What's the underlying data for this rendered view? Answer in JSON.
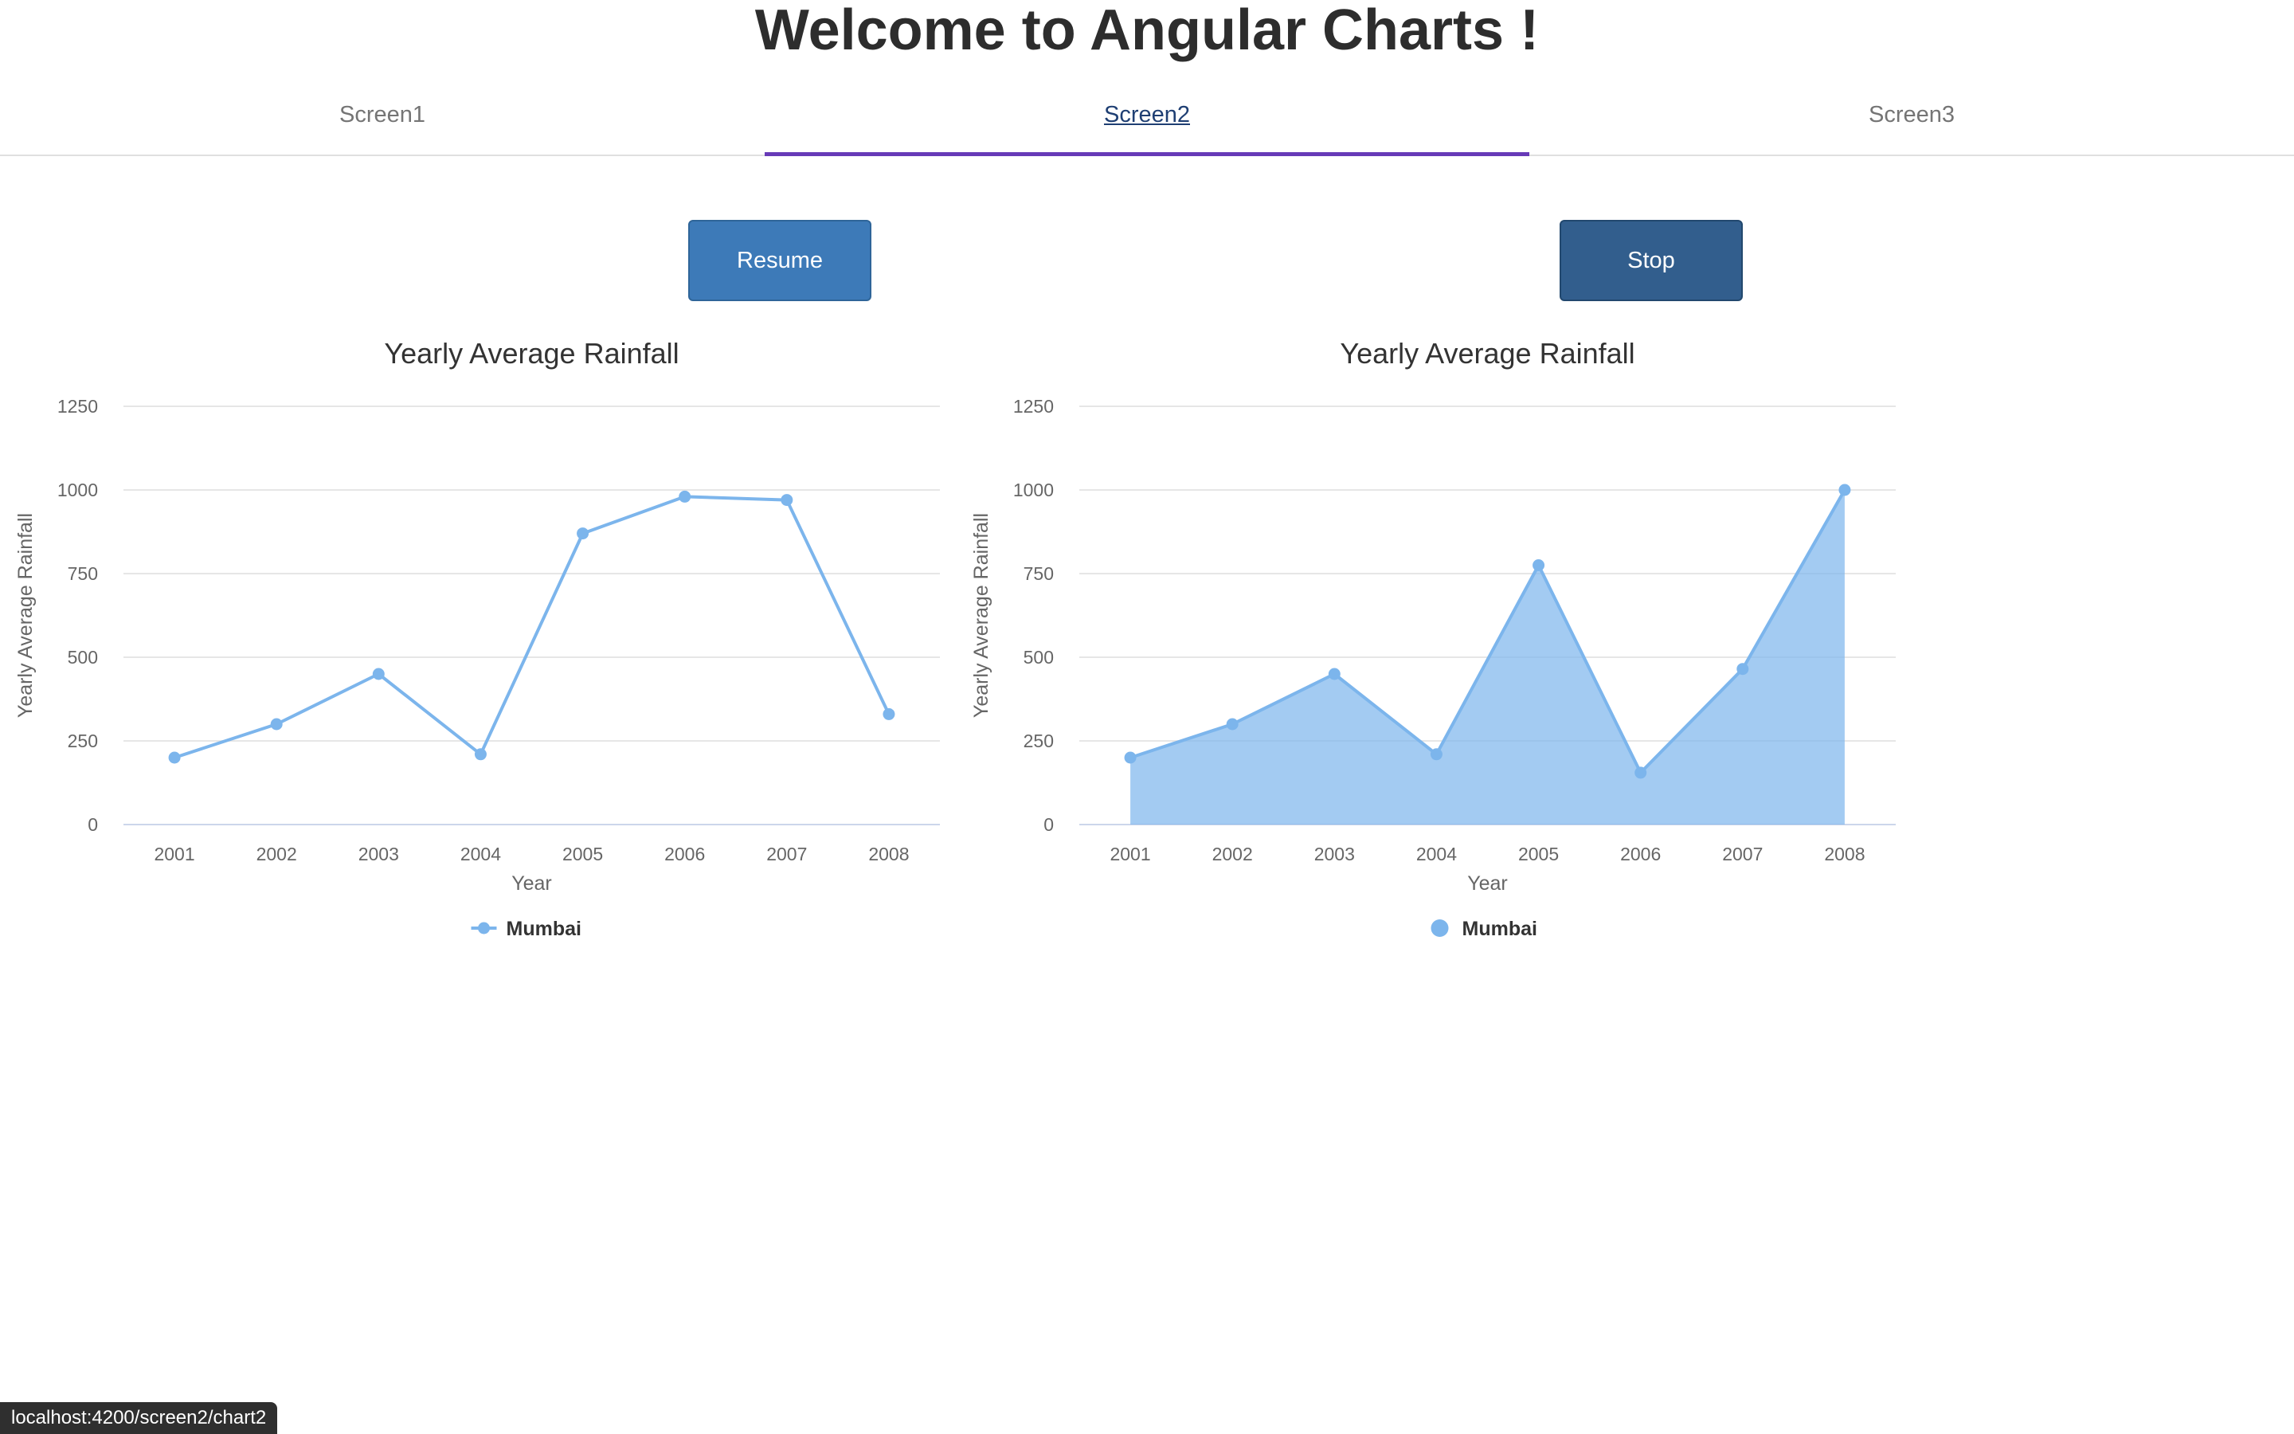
{
  "header": {
    "title": "Welcome to Angular Charts !"
  },
  "tabs": [
    {
      "label": "Screen1",
      "active": false
    },
    {
      "label": "Screen2",
      "active": true
    },
    {
      "label": "Screen3",
      "active": false
    }
  ],
  "controls": {
    "resume_label": "Resume",
    "stop_label": "Stop"
  },
  "status_bar": {
    "url": "localhost:4200/screen2/chart2"
  },
  "colors": {
    "series": "#7cb5ec",
    "active_tab_underline": "#673ab7",
    "resume_button": "#3d7ab8",
    "stop_button": "#325e8d"
  },
  "chart_data": [
    {
      "type": "line",
      "title": "Yearly Average Rainfall",
      "xlabel": "Year",
      "ylabel": "Yearly Average Rainfall",
      "categories": [
        "2001",
        "2002",
        "2003",
        "2004",
        "2005",
        "2006",
        "2007",
        "2008"
      ],
      "series": [
        {
          "name": "Mumbai",
          "values": [
            200,
            300,
            450,
            210,
            870,
            980,
            970,
            330
          ]
        }
      ],
      "ylim": [
        0,
        1250
      ],
      "yticks": [
        0,
        250,
        500,
        750,
        1000,
        1250
      ],
      "grid": true,
      "legend": "bottom-center"
    },
    {
      "type": "area",
      "title": "Yearly Average Rainfall",
      "xlabel": "Year",
      "ylabel": "Yearly Average Rainfall",
      "categories": [
        "2001",
        "2002",
        "2003",
        "2004",
        "2005",
        "2006",
        "2007",
        "2008"
      ],
      "series": [
        {
          "name": "Mumbai",
          "values": [
            200,
            300,
            450,
            210,
            775,
            155,
            465,
            1000
          ]
        }
      ],
      "ylim": [
        0,
        1250
      ],
      "yticks": [
        0,
        250,
        500,
        750,
        1000,
        1250
      ],
      "grid": true,
      "legend": "bottom-center"
    }
  ]
}
